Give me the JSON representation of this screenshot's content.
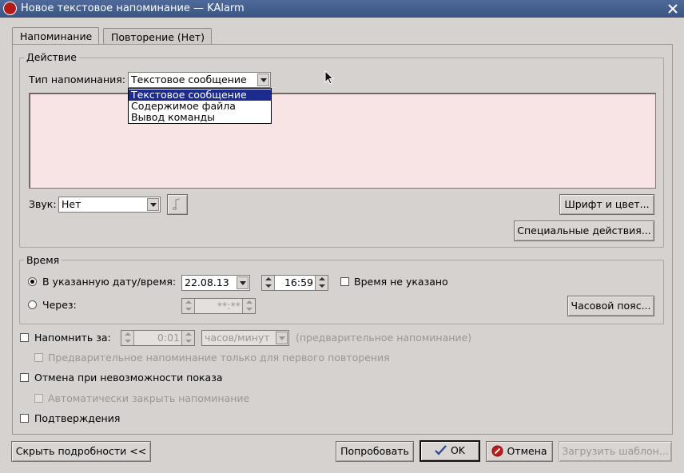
{
  "window": {
    "title": "Новое текстовое напоминание — KAlarm"
  },
  "tabs": [
    {
      "label": "Напоминание",
      "active": true
    },
    {
      "label": "Повторение (Нет)",
      "active": false
    }
  ],
  "action": {
    "group_title": "Действие",
    "type_label": "Тип напоминания:",
    "type_value": "Текстовое сообщение",
    "type_options": [
      "Текстовое сообщение",
      "Содержимое файла",
      "Вывод команды"
    ],
    "type_selected_index": 0,
    "message_text": "",
    "sound_label": "Звук:",
    "sound_value": "Нет",
    "font_button": "Шрифт и цвет...",
    "special_button": "Специальные действия..."
  },
  "time": {
    "group_title": "Время",
    "at_date_label": "В указанную дату/время:",
    "date_value": "22.08.13",
    "time_value": "16:59",
    "any_time_label": "Время не указано",
    "after_label": "Через:",
    "after_value": "**:**",
    "timezone_button": "Часовой пояс..."
  },
  "options": {
    "reminder_label": "Напомнить за:",
    "reminder_value": "0:01",
    "reminder_units": "часов/минут",
    "reminder_hint": "(предварительное напоминание)",
    "reminder_first_only": "Предварительное напоминание только для первого повторения",
    "cancel_if_late": "Отмена при невозможности показа",
    "auto_close": "Автоматически закрыть напоминание",
    "confirm_ack": "Подтверждения"
  },
  "buttons": {
    "hide_details": "Скрыть подробности <<",
    "try": "Попробовать",
    "ok": "OK",
    "cancel": "Отмена",
    "load_template": "Загрузить шаблон..."
  },
  "colors": {
    "titlebar": "#3a5483",
    "text_bg": "#f8e4e4",
    "selection": "#1c2b8e",
    "dialog_bg": "#d6d2d0"
  }
}
